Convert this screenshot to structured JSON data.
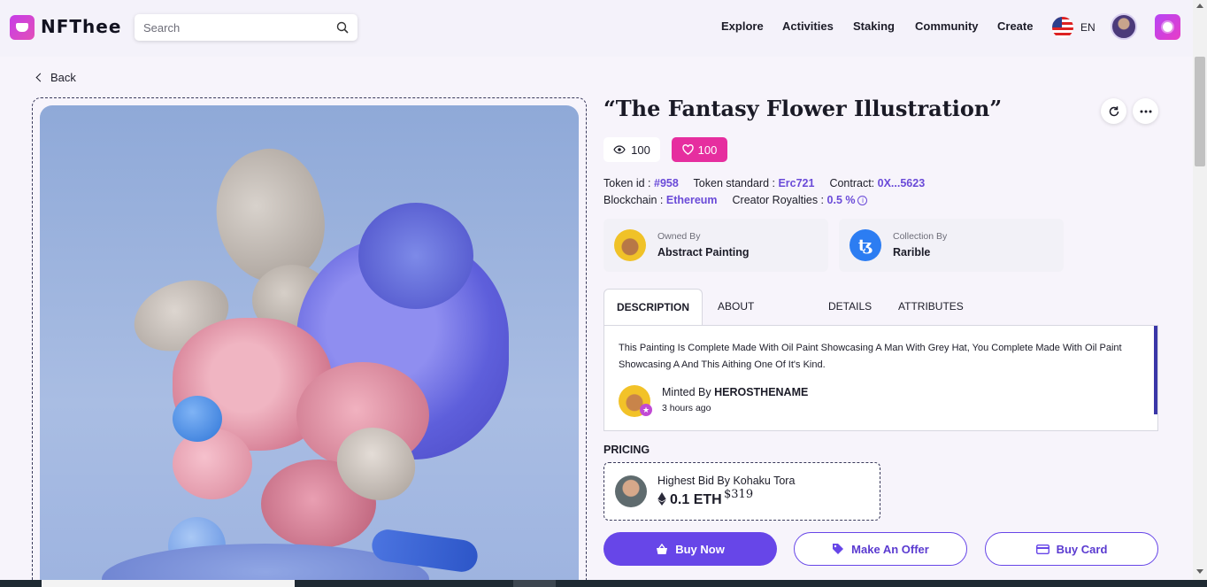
{
  "header": {
    "brand": "NFThee",
    "search_placeholder": "Search",
    "nav": [
      "Explore",
      "Activities",
      "Staking",
      "Community",
      "Create"
    ],
    "language": "EN"
  },
  "back_label": "Back",
  "nft": {
    "title": "“The Fantasy Flower Illustration”",
    "views": "100",
    "likes": "100",
    "token_id_label": "Token id :",
    "token_id": "#958",
    "token_standard_label": "Token standard :",
    "token_standard": "Erc721",
    "contract_label": "Contract:",
    "contract": "0X...5623",
    "blockchain_label": "Blockchain :",
    "blockchain": "Ethereum",
    "royalties_label": "Creator Royalties :",
    "royalties": "0.5 %"
  },
  "owner": {
    "label": "Owned By",
    "name": "Abstract Painting"
  },
  "collection": {
    "label": "Collection By",
    "name": "Rarible"
  },
  "tabs": [
    "DESCRIPTION",
    "ABOUT PROJECT",
    "DETAILS",
    "ATTRIBUTES"
  ],
  "description": {
    "text": "This Painting Is Complete Made With Oil Paint Showcasing A Man With Grey Hat, You Complete Made With Oil Paint Showcasing A And This Aithing One Of It's Kind.",
    "minted_prefix": "Minted By",
    "minted_by": "HEROSTHENAME",
    "minted_time": "3 hours ago"
  },
  "pricing": {
    "heading": "PRICING",
    "bid_label": "Highest Bid By Kohaku Tora",
    "bid_eth": "0.1 ETH",
    "bid_usd": "$319"
  },
  "actions": {
    "buy_now": "Buy Now",
    "make_offer": "Make An Offer",
    "buy_card": "Buy Card"
  },
  "colors": {
    "accent": "#6746e8",
    "like": "#e62e9f",
    "link": "#6a4ad8"
  }
}
